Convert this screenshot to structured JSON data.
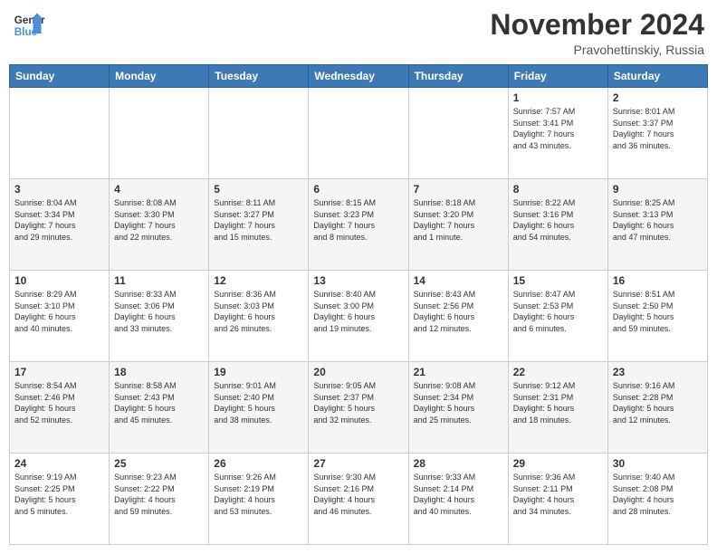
{
  "logo": {
    "line1": "General",
    "line2": "Blue"
  },
  "title": "November 2024",
  "location": "Pravohettinskiy, Russia",
  "days_header": [
    "Sunday",
    "Monday",
    "Tuesday",
    "Wednesday",
    "Thursday",
    "Friday",
    "Saturday"
  ],
  "weeks": [
    [
      {
        "day": "",
        "info": ""
      },
      {
        "day": "",
        "info": ""
      },
      {
        "day": "",
        "info": ""
      },
      {
        "day": "",
        "info": ""
      },
      {
        "day": "",
        "info": ""
      },
      {
        "day": "1",
        "info": "Sunrise: 7:57 AM\nSunset: 3:41 PM\nDaylight: 7 hours\nand 43 minutes."
      },
      {
        "day": "2",
        "info": "Sunrise: 8:01 AM\nSunset: 3:37 PM\nDaylight: 7 hours\nand 36 minutes."
      }
    ],
    [
      {
        "day": "3",
        "info": "Sunrise: 8:04 AM\nSunset: 3:34 PM\nDaylight: 7 hours\nand 29 minutes."
      },
      {
        "day": "4",
        "info": "Sunrise: 8:08 AM\nSunset: 3:30 PM\nDaylight: 7 hours\nand 22 minutes."
      },
      {
        "day": "5",
        "info": "Sunrise: 8:11 AM\nSunset: 3:27 PM\nDaylight: 7 hours\nand 15 minutes."
      },
      {
        "day": "6",
        "info": "Sunrise: 8:15 AM\nSunset: 3:23 PM\nDaylight: 7 hours\nand 8 minutes."
      },
      {
        "day": "7",
        "info": "Sunrise: 8:18 AM\nSunset: 3:20 PM\nDaylight: 7 hours\nand 1 minute."
      },
      {
        "day": "8",
        "info": "Sunrise: 8:22 AM\nSunset: 3:16 PM\nDaylight: 6 hours\nand 54 minutes."
      },
      {
        "day": "9",
        "info": "Sunrise: 8:25 AM\nSunset: 3:13 PM\nDaylight: 6 hours\nand 47 minutes."
      }
    ],
    [
      {
        "day": "10",
        "info": "Sunrise: 8:29 AM\nSunset: 3:10 PM\nDaylight: 6 hours\nand 40 minutes."
      },
      {
        "day": "11",
        "info": "Sunrise: 8:33 AM\nSunset: 3:06 PM\nDaylight: 6 hours\nand 33 minutes."
      },
      {
        "day": "12",
        "info": "Sunrise: 8:36 AM\nSunset: 3:03 PM\nDaylight: 6 hours\nand 26 minutes."
      },
      {
        "day": "13",
        "info": "Sunrise: 8:40 AM\nSunset: 3:00 PM\nDaylight: 6 hours\nand 19 minutes."
      },
      {
        "day": "14",
        "info": "Sunrise: 8:43 AM\nSunset: 2:56 PM\nDaylight: 6 hours\nand 12 minutes."
      },
      {
        "day": "15",
        "info": "Sunrise: 8:47 AM\nSunset: 2:53 PM\nDaylight: 6 hours\nand 6 minutes."
      },
      {
        "day": "16",
        "info": "Sunrise: 8:51 AM\nSunset: 2:50 PM\nDaylight: 5 hours\nand 59 minutes."
      }
    ],
    [
      {
        "day": "17",
        "info": "Sunrise: 8:54 AM\nSunset: 2:46 PM\nDaylight: 5 hours\nand 52 minutes."
      },
      {
        "day": "18",
        "info": "Sunrise: 8:58 AM\nSunset: 2:43 PM\nDaylight: 5 hours\nand 45 minutes."
      },
      {
        "day": "19",
        "info": "Sunrise: 9:01 AM\nSunset: 2:40 PM\nDaylight: 5 hours\nand 38 minutes."
      },
      {
        "day": "20",
        "info": "Sunrise: 9:05 AM\nSunset: 2:37 PM\nDaylight: 5 hours\nand 32 minutes."
      },
      {
        "day": "21",
        "info": "Sunrise: 9:08 AM\nSunset: 2:34 PM\nDaylight: 5 hours\nand 25 minutes."
      },
      {
        "day": "22",
        "info": "Sunrise: 9:12 AM\nSunset: 2:31 PM\nDaylight: 5 hours\nand 18 minutes."
      },
      {
        "day": "23",
        "info": "Sunrise: 9:16 AM\nSunset: 2:28 PM\nDaylight: 5 hours\nand 12 minutes."
      }
    ],
    [
      {
        "day": "24",
        "info": "Sunrise: 9:19 AM\nSunset: 2:25 PM\nDaylight: 5 hours\nand 5 minutes."
      },
      {
        "day": "25",
        "info": "Sunrise: 9:23 AM\nSunset: 2:22 PM\nDaylight: 4 hours\nand 59 minutes."
      },
      {
        "day": "26",
        "info": "Sunrise: 9:26 AM\nSunset: 2:19 PM\nDaylight: 4 hours\nand 53 minutes."
      },
      {
        "day": "27",
        "info": "Sunrise: 9:30 AM\nSunset: 2:16 PM\nDaylight: 4 hours\nand 46 minutes."
      },
      {
        "day": "28",
        "info": "Sunrise: 9:33 AM\nSunset: 2:14 PM\nDaylight: 4 hours\nand 40 minutes."
      },
      {
        "day": "29",
        "info": "Sunrise: 9:36 AM\nSunset: 2:11 PM\nDaylight: 4 hours\nand 34 minutes."
      },
      {
        "day": "30",
        "info": "Sunrise: 9:40 AM\nSunset: 2:08 PM\nDaylight: 4 hours\nand 28 minutes."
      }
    ]
  ]
}
